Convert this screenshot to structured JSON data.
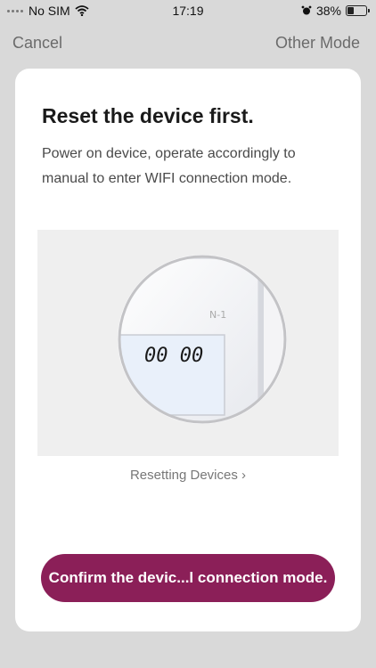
{
  "status_bar": {
    "carrier": "No SIM",
    "time": "17:19",
    "battery": "38%"
  },
  "nav": {
    "cancel": "Cancel",
    "other_mode": "Other Mode"
  },
  "card": {
    "title": "Reset the device first.",
    "description": "Power on device, operate accordingly to manual to enter WIFI connection mode.",
    "device_model": "N-1",
    "display_value": "00 00",
    "reset_link": "Resetting Devices",
    "confirm_button": "Confirm the devic...l connection mode."
  },
  "colors": {
    "accent": "#8b1f58",
    "background": "#d9d9d9"
  },
  "icons": [
    "signal-dots-icon",
    "wifi-icon",
    "alarm-icon",
    "battery-icon",
    "chevron-right-icon"
  ]
}
